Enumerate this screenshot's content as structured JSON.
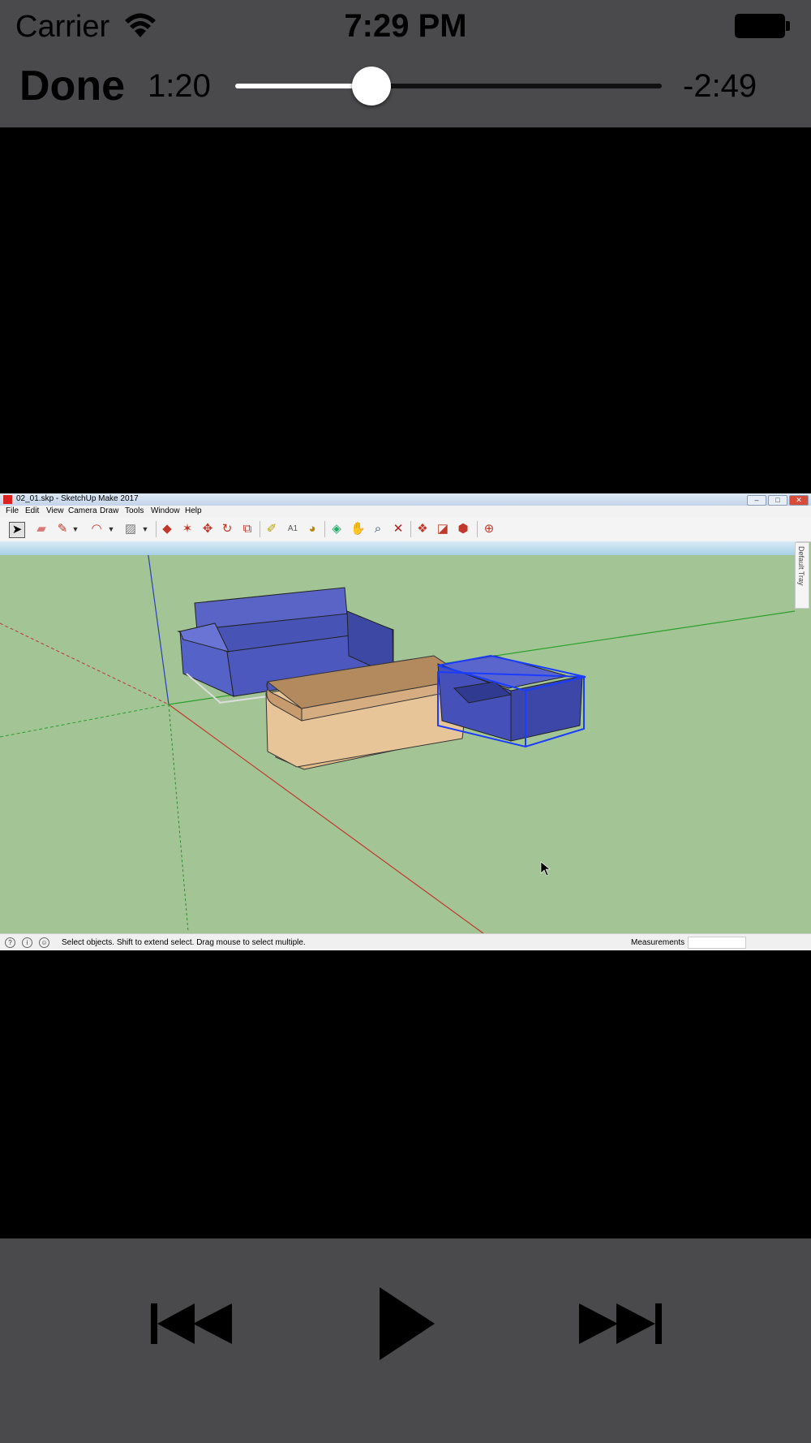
{
  "status_bar": {
    "carrier": "Carrier",
    "time": "7:29 PM"
  },
  "player": {
    "done_label": "Done",
    "elapsed": "1:20",
    "remaining": "-2:49",
    "progress_fraction": 0.32
  },
  "video_frame": {
    "window_title": "02_01.skp - SketchUp Make 2017",
    "menu": [
      "File",
      "Edit",
      "View",
      "Camera",
      "Draw",
      "Tools",
      "Window",
      "Help"
    ],
    "tray_label": "Default Tray",
    "status_message": "Select objects. Shift to extend select. Drag mouse to select multiple.",
    "measurements_label": "Measurements"
  },
  "controls": {
    "previous": "skip-back-icon",
    "play": "play-icon",
    "next": "skip-forward-icon"
  }
}
